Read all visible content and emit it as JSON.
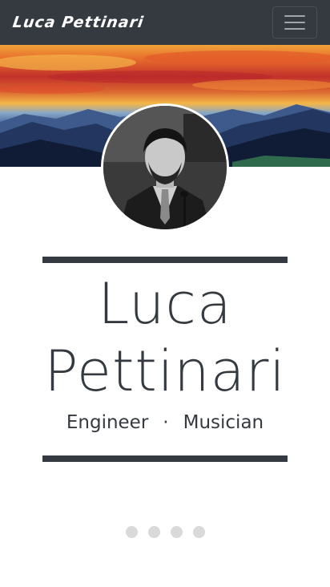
{
  "navbar": {
    "brand": "Luca Pettinari",
    "toggler_icon": "hamburger-icon"
  },
  "hero": {
    "image": "sunset-mountain-landscape"
  },
  "profile": {
    "avatar": "portrait-photo",
    "first_name": "Luca",
    "last_name": "Pettinari",
    "role_1": "Engineer",
    "separator": "·",
    "role_2": "Musician"
  },
  "carousel": {
    "indicator_count": 4
  },
  "colors": {
    "dark": "#343a40",
    "indicator": "#d9d9d9"
  }
}
